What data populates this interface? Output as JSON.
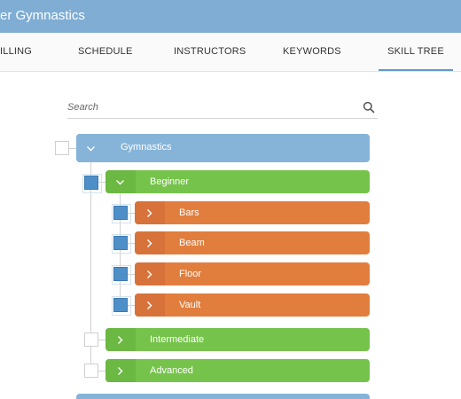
{
  "header": {
    "title": "er Gymnastics"
  },
  "tabs": [
    {
      "label": "ILLING",
      "active": false
    },
    {
      "label": "SCHEDULE",
      "active": false
    },
    {
      "label": "INSTRUCTORS",
      "active": false
    },
    {
      "label": "KEYWORDS",
      "active": false
    },
    {
      "label": "SKILL TREE",
      "active": true
    }
  ],
  "search": {
    "placeholder": "Search",
    "value": "",
    "icon": "search-icon"
  },
  "tree": {
    "root": {
      "label": "Gymnastics",
      "expanded": true,
      "checked": false,
      "color": "#86b4d9"
    },
    "levels": [
      {
        "label": "Beginner",
        "expanded": true,
        "checked": true,
        "color": "#76c34c"
      },
      {
        "label": "Intermediate",
        "expanded": false,
        "checked": false,
        "color": "#76c34c"
      },
      {
        "label": "Advanced",
        "expanded": false,
        "checked": false,
        "color": "#76c34c"
      }
    ],
    "beginner_skills": [
      {
        "label": "Bars",
        "checked": true,
        "color": "#e17e3e"
      },
      {
        "label": "Beam",
        "checked": true,
        "color": "#e17e3e"
      },
      {
        "label": "Floor",
        "checked": true,
        "color": "#e17e3e"
      },
      {
        "label": "Vault",
        "checked": true,
        "color": "#e17e3e"
      }
    ]
  },
  "colors": {
    "header": "#7fadd3",
    "accent": "#5f9ad0",
    "checkbox_checked": "#4f8fc8"
  }
}
